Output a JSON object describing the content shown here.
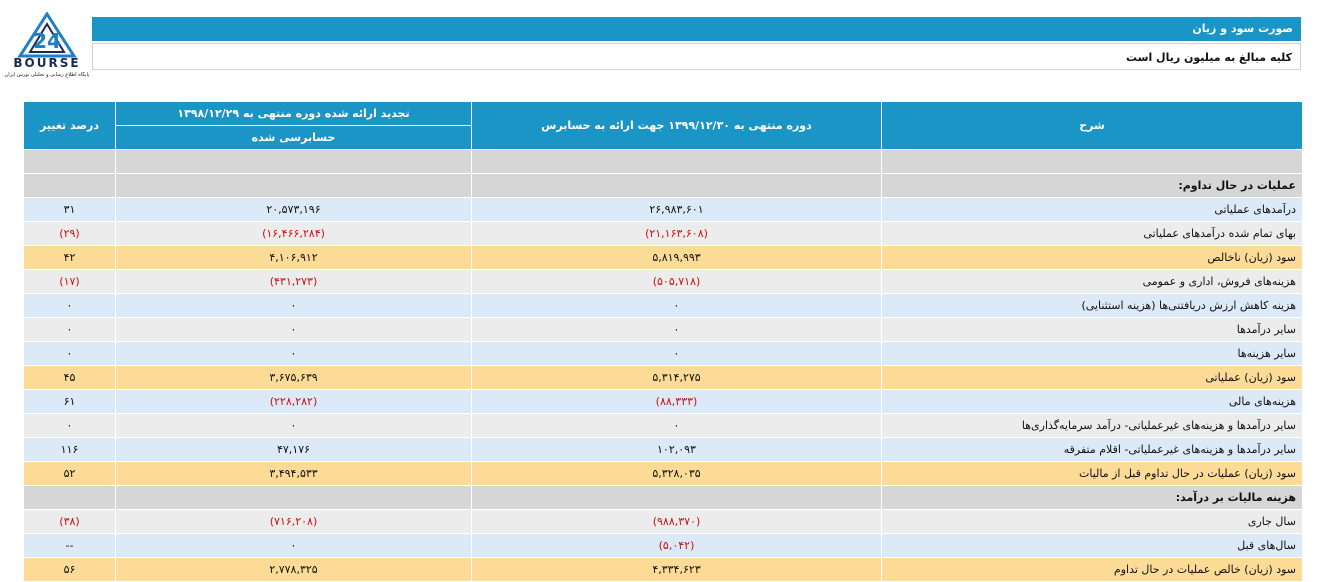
{
  "logo": {
    "wordmark": "BOURSE",
    "number": "24",
    "tagline": "پایگاه اطلاع رسانی و تحلیلی بورس ایران"
  },
  "header": {
    "title": "صورت سود و زیان",
    "note": "کلیه مبالغ به میلیون ریال است"
  },
  "table": {
    "headers": {
      "desc": "شرح",
      "current": "دوره منتهی به ۱۳۹۹/۱۲/۳۰ جهت ارائه به حسابرس",
      "previous": "تجدید ارائه شده دوره منتهی به ۱۳۹۸/۱۲/۲۹",
      "previous_sub": "حسابرسی شده",
      "change": "درصد تغییر"
    },
    "rows": [
      {
        "style": "sec",
        "label": "",
        "current": "",
        "previous": "",
        "change": ""
      },
      {
        "style": "sec",
        "label": "عملیات در حال تداوم:",
        "current": "",
        "previous": "",
        "change": ""
      },
      {
        "style": "blue",
        "label": "درآمدهای عملیاتی",
        "current": "۲۶,۹۸۳,۶۰۱",
        "previous": "۲۰,۵۷۳,۱۹۶",
        "change": "۳۱"
      },
      {
        "style": "gray",
        "label": "بهای تمام شده درآمدهای عملیاتی",
        "current": "(۲۱,۱۶۳,۶۰۸)",
        "previous": "(۱۶,۴۶۶,۲۸۴)",
        "change": "(۲۹)"
      },
      {
        "style": "gold",
        "label": "سود (زیان) ناخالص",
        "current": "۵,۸۱۹,۹۹۳",
        "previous": "۴,۱۰۶,۹۱۲",
        "change": "۴۲"
      },
      {
        "style": "gray",
        "label": "هزینه‌های فروش، اداری و عمومی",
        "current": "(۵۰۵,۷۱۸)",
        "previous": "(۴۳۱,۲۷۳)",
        "change": "(۱۷)"
      },
      {
        "style": "blue",
        "label": "هزینه کاهش ارزش دریافتنی‌ها (هزینه استثنایی)",
        "current": "۰",
        "previous": "۰",
        "change": "۰"
      },
      {
        "style": "gray",
        "label": "سایر درآمدها",
        "current": "۰",
        "previous": "۰",
        "change": "۰"
      },
      {
        "style": "blue",
        "label": "سایر هزینه‌ها",
        "current": "۰",
        "previous": "۰",
        "change": "۰"
      },
      {
        "style": "gold",
        "label": "سود (زیان) عملیاتی",
        "current": "۵,۳۱۴,۲۷۵",
        "previous": "۳,۶۷۵,۶۳۹",
        "change": "۴۵"
      },
      {
        "style": "blue",
        "label": "هزینه‌های مالی",
        "current": "(۸۸,۳۳۳)",
        "previous": "(۲۲۸,۲۸۲)",
        "change": "۶۱"
      },
      {
        "style": "gray",
        "label": "سایر درآمدها و هزینه‌های غیرعملیاتی- درآمد سرمایه‌گذاری‌ها",
        "current": "۰",
        "previous": "۰",
        "change": "۰"
      },
      {
        "style": "blue",
        "label": "سایر درآمدها و هزینه‌های غیرعملیاتی- اقلام متفرقه",
        "current": "۱۰۲,۰۹۳",
        "previous": "۴۷,۱۷۶",
        "change": "۱۱۶"
      },
      {
        "style": "gold",
        "label": "سود (زیان) عملیات در حال تداوم قبل از مالیات",
        "current": "۵,۳۲۸,۰۳۵",
        "previous": "۳,۴۹۴,۵۳۳",
        "change": "۵۲"
      },
      {
        "style": "sec",
        "label": "هزینه مالیات بر درآمد:",
        "current": "",
        "previous": "",
        "change": ""
      },
      {
        "style": "gray",
        "label": "سال جاری",
        "current": "(۹۸۸,۳۷۰)",
        "previous": "(۷۱۶,۲۰۸)",
        "change": "(۳۸)"
      },
      {
        "style": "blue",
        "label": "سال‌های قبل",
        "current": "(۵,۰۴۲)",
        "previous": "۰",
        "change": "--"
      },
      {
        "style": "gold",
        "label": "سود (زیان) خالص عملیات در حال تداوم",
        "current": "۴,۳۳۴,۶۲۳",
        "previous": "۲,۷۷۸,۳۲۵",
        "change": "۵۶"
      }
    ]
  }
}
